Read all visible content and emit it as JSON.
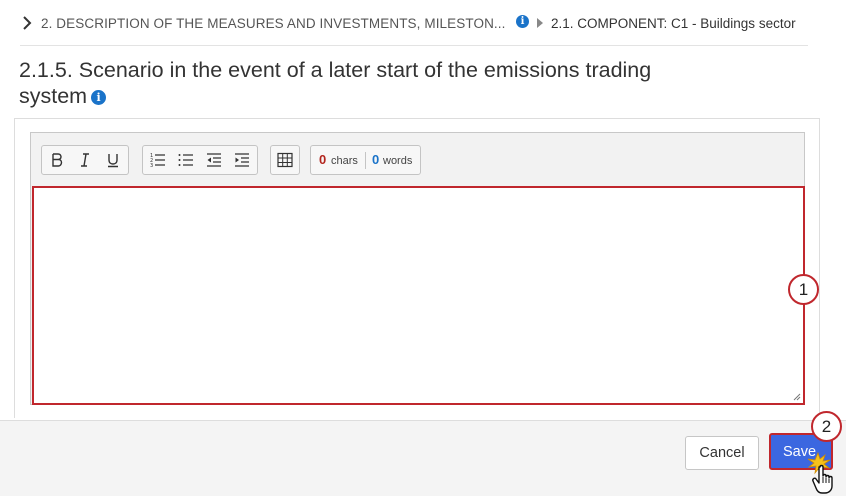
{
  "breadcrumb": {
    "parent_label": "2. DESCRIPTION OF THE MEASURES AND INVESTMENTS, MILESTON...",
    "info_icon": "info-icon",
    "current_label": "2.1. COMPONENT: C1 - Buildings sector"
  },
  "section": {
    "title": "2.1.5. Scenario in the event of a later start of the emissions trading system",
    "info_icon": "info-icon"
  },
  "editor": {
    "toolbar": [
      {
        "group": "format",
        "icons": [
          "bold-icon",
          "italic-icon",
          "underline-icon"
        ]
      },
      {
        "group": "lists",
        "icons": [
          "ordered-list-icon",
          "bullet-list-icon",
          "outdent-icon",
          "indent-icon"
        ]
      },
      {
        "group": "insert",
        "icons": [
          "table-icon"
        ]
      }
    ],
    "chars_count": "0",
    "chars_label": "chars",
    "words_count": "0",
    "words_label": "words",
    "value": ""
  },
  "markers": {
    "first": "1",
    "second": "2"
  },
  "footer": {
    "cancel_label": "Cancel",
    "save_label": "Save"
  },
  "colors": {
    "accent_blue": "#3b67e0",
    "highlight_red": "#c0272d",
    "info_blue": "#1a73c9"
  }
}
